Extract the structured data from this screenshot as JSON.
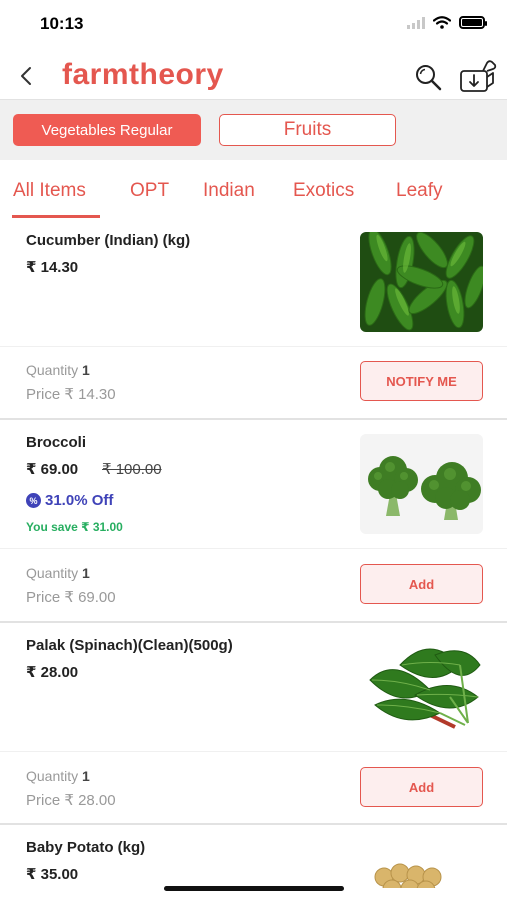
{
  "status": {
    "time": "10:13"
  },
  "header": {
    "logo": "farmtheory"
  },
  "categories": [
    {
      "label": "Vegetables Regular",
      "active": true
    },
    {
      "label": "Fruits",
      "active": false
    }
  ],
  "tabs": [
    {
      "label": "All Items",
      "active": true
    },
    {
      "label": "OPT",
      "active": false
    },
    {
      "label": "Indian",
      "active": false
    },
    {
      "label": "Exotics",
      "active": false
    },
    {
      "label": "Leafy",
      "active": false
    }
  ],
  "products": [
    {
      "name": "Cucumber (Indian) (kg)",
      "price": "₹ 14.30",
      "quantity_label": "Quantity",
      "quantity": "1",
      "line_price_label": "Price",
      "line_price": "₹ 14.30",
      "button": "NOTIFY ME",
      "image": "cucumbers"
    },
    {
      "name": "Broccoli",
      "price": "₹ 69.00",
      "mrp": "₹ 100.00",
      "discount_badge": "%",
      "discount": "31.0% Off",
      "you_save": "You save ₹ 31.00",
      "quantity_label": "Quantity",
      "quantity": "1",
      "line_price_label": "Price",
      "line_price": "₹ 69.00",
      "button": "Add",
      "image": "broccoli"
    },
    {
      "name": "Palak (Spinach)(Clean)(500g)",
      "price": "₹ 28.00",
      "quantity_label": "Quantity",
      "quantity": "1",
      "line_price_label": "Price",
      "line_price": "₹ 28.00",
      "button": "Add",
      "image": "spinach"
    },
    {
      "name": "Baby Potato (kg)",
      "price": "₹ 35.00",
      "image": "baby-potatoes"
    }
  ],
  "colors": {
    "brand": "#e4574f",
    "discount": "#3f43b8",
    "savings": "#27ae60"
  }
}
